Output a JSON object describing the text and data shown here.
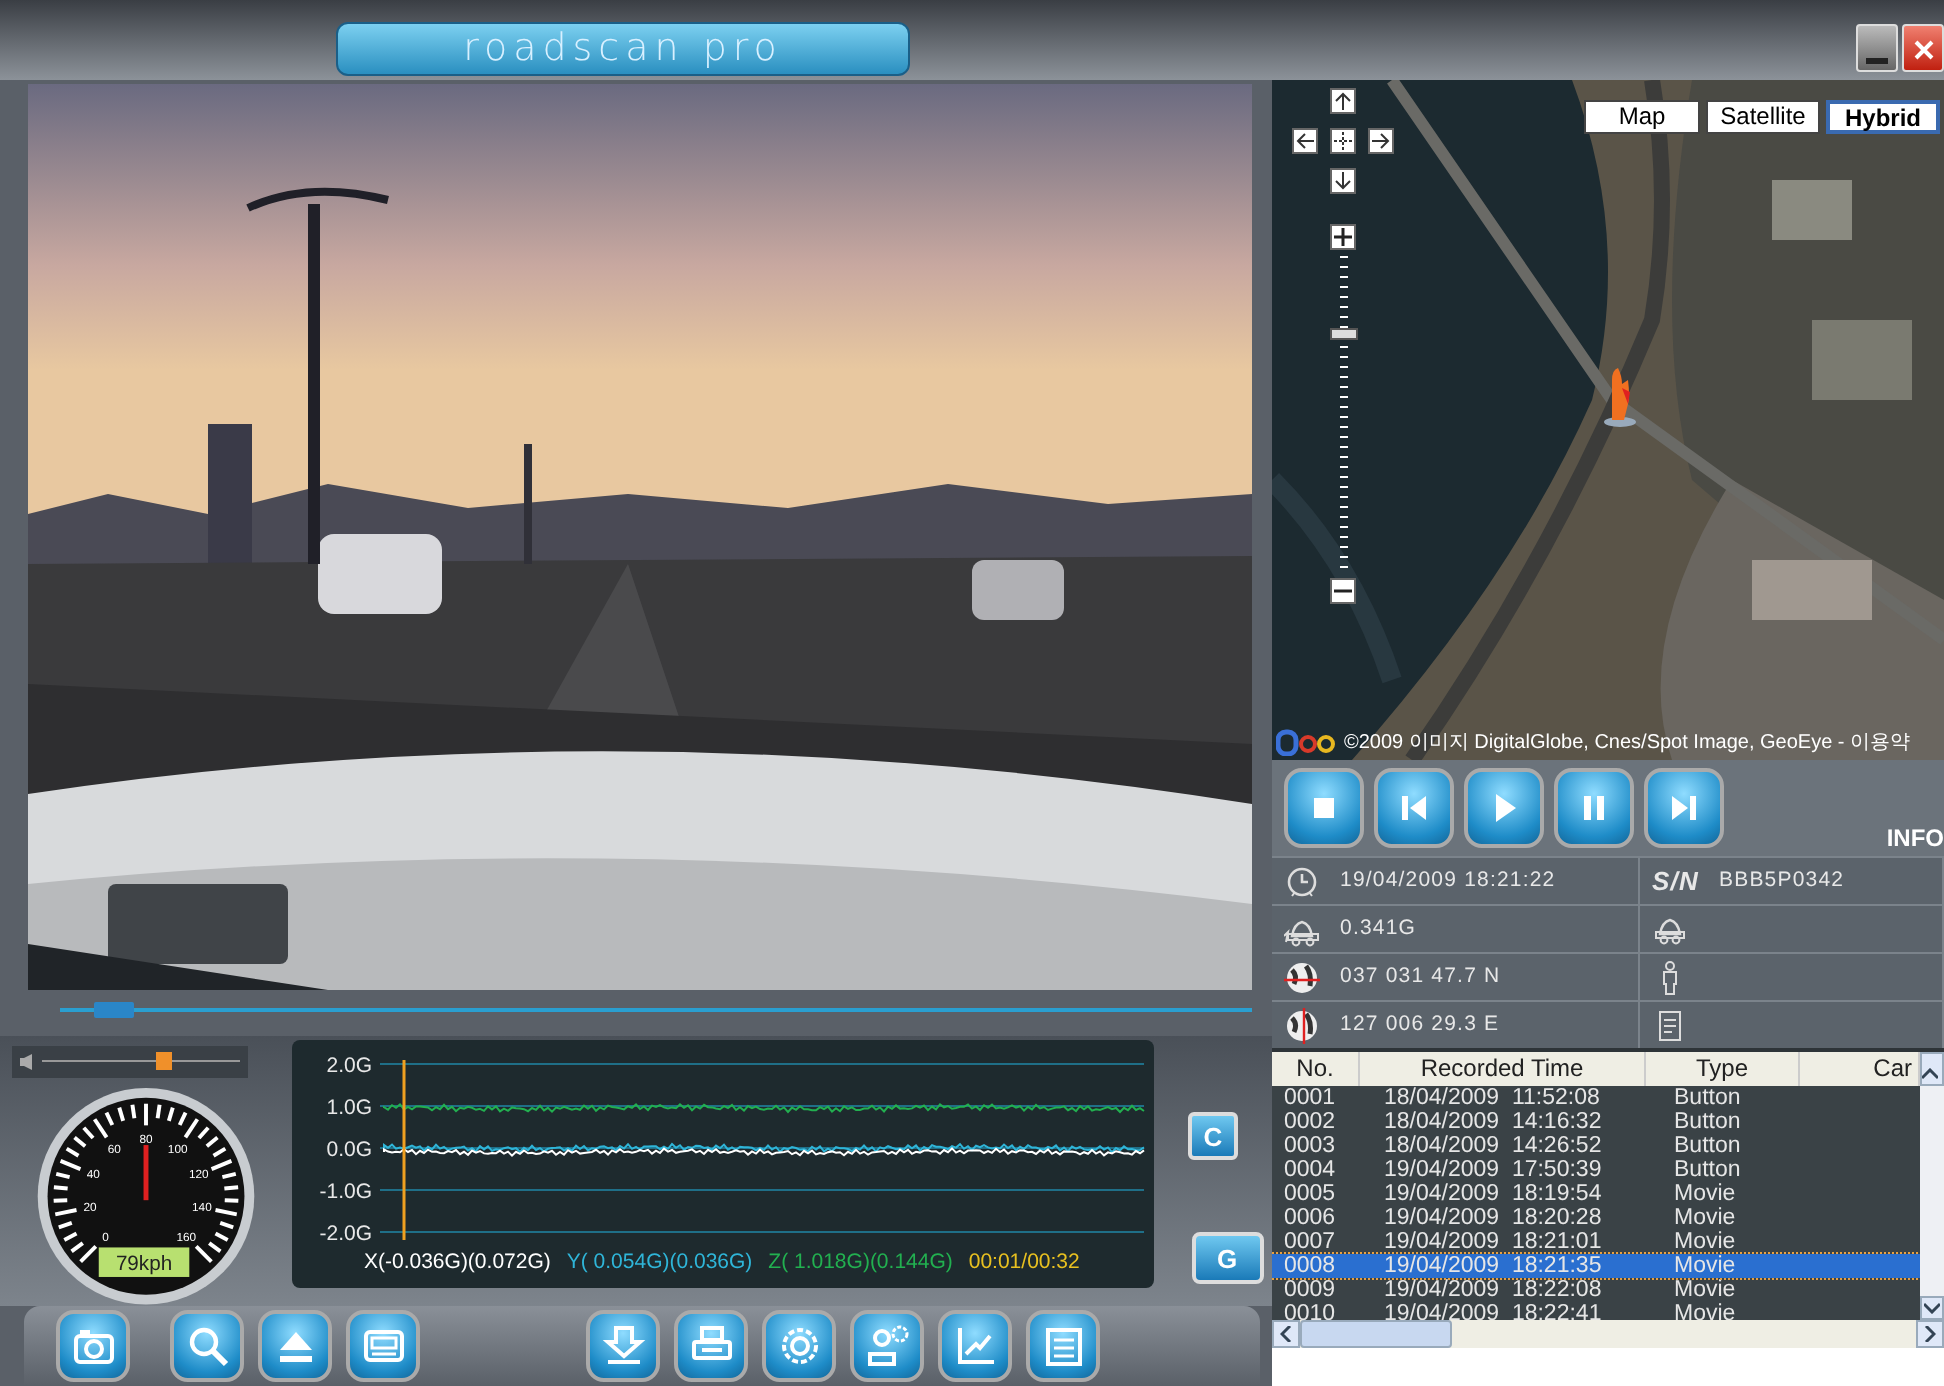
{
  "app": {
    "title": "roadscan pro"
  },
  "seek_bar": {
    "level": 0.03
  },
  "volume": {
    "level": 0.62
  },
  "speedometer": {
    "labels": [
      "0",
      "20",
      "40",
      "60",
      "80",
      "100",
      "120",
      "140",
      "160"
    ],
    "readout": "79kph"
  },
  "accel_graph": {
    "y_tick_labels": [
      "2.0G",
      "1.0G",
      "0.0G",
      "-1.0G",
      "-2.0G"
    ],
    "legend": [
      {
        "text": "X(-0.036G)(0.072G)",
        "color": "#ffffff"
      },
      {
        "text": "Y( 0.054G)(0.036G)",
        "color": "#2fb5d8"
      },
      {
        "text": "Z( 1.018G)(0.144G)",
        "color": "#22b050"
      },
      {
        "text": "00:01/00:32",
        "color": "#e8c020"
      }
    ]
  },
  "side_buttons": [
    "C",
    "G"
  ],
  "map": {
    "zoom": {
      "level": 0.76
    },
    "types": [
      {
        "label": "Map",
        "selected": false
      },
      {
        "label": "Satellite",
        "selected": false
      },
      {
        "label": "Hybrid",
        "selected": true
      }
    ],
    "attribution": "©2009 이미지 DigitalGlobe, Cnes/Spot Image, GeoEye - 이용약"
  },
  "info": {
    "heading": "INFO",
    "time": "19/04/2009 18:21:22",
    "serial_label": "S/N",
    "serial": "BBB5P0342",
    "impact": "0.341G",
    "latitude": "037 031 47.7 N",
    "longitude": "127 006 29.3 E"
  },
  "records": {
    "columns": [
      "No.",
      "Recorded Time",
      "Type",
      "Car"
    ],
    "rows": [
      {
        "cells": [
          "0001",
          "18/04/2009  11:52:08",
          "Button"
        ],
        "selected": false
      },
      {
        "cells": [
          "0002",
          "18/04/2009  14:16:32",
          "Button"
        ],
        "selected": false
      },
      {
        "cells": [
          "0003",
          "18/04/2009  14:26:52",
          "Button"
        ],
        "selected": false
      },
      {
        "cells": [
          "0004",
          "19/04/2009  17:50:39",
          "Button"
        ],
        "selected": false
      },
      {
        "cells": [
          "0005",
          "19/04/2009  18:19:54",
          "Movie"
        ],
        "selected": false
      },
      {
        "cells": [
          "0006",
          "19/04/2009  18:20:28",
          "Movie"
        ],
        "selected": false
      },
      {
        "cells": [
          "0007",
          "19/04/2009  18:21:01",
          "Movie"
        ],
        "selected": false
      },
      {
        "cells": [
          "0008",
          "19/04/2009  18:21:35",
          "Movie"
        ],
        "selected": true
      },
      {
        "cells": [
          "0009",
          "19/04/2009  18:22:08",
          "Movie"
        ],
        "selected": false
      },
      {
        "cells": [
          "0010",
          "19/04/2009  18:22:41",
          "Movie"
        ],
        "selected": false
      }
    ]
  }
}
